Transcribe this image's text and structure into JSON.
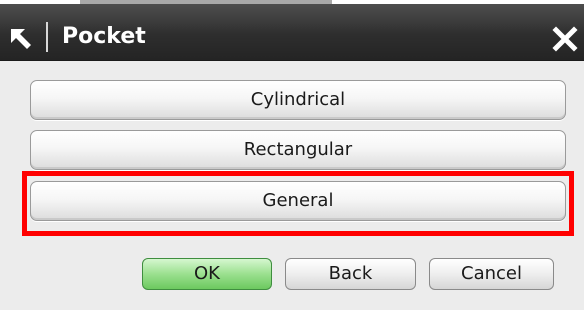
{
  "window": {
    "title": "Pocket",
    "title_icon": "select-arrow-icon",
    "close_icon": "close-icon"
  },
  "options": [
    {
      "label": "Cylindrical"
    },
    {
      "label": "Rectangular"
    },
    {
      "label": "General"
    }
  ],
  "highlight": {
    "target": "General",
    "color": "#ff0000"
  },
  "actions": {
    "ok_label": "OK",
    "back_label": "Back",
    "cancel_label": "Cancel"
  },
  "colors": {
    "titlebar": "#2e2e2e",
    "ok_button": "#9be08f",
    "dialog_body": "#ececec"
  }
}
